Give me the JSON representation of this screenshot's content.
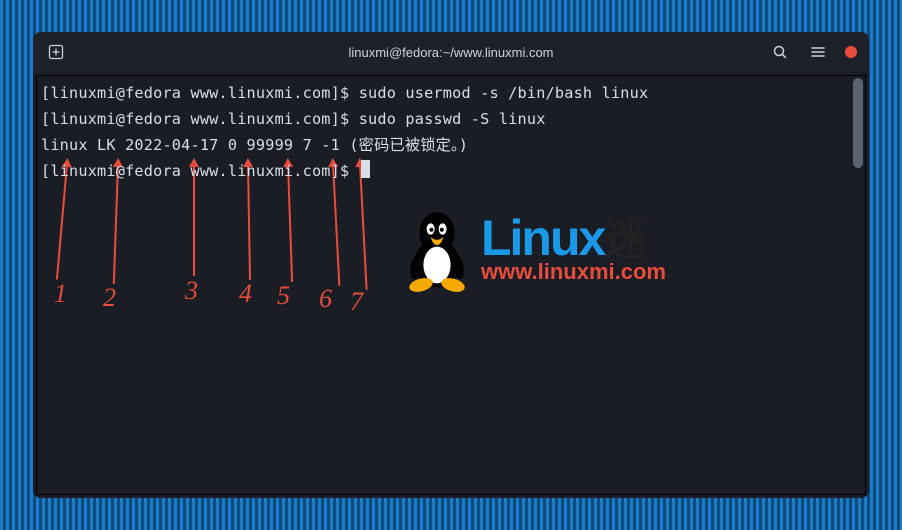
{
  "title": "linuxmi@fedora:~/www.linuxmi.com",
  "prompt": "[linuxmi@fedora www.linuxmi.com]$ ",
  "lines": {
    "cmd1": "sudo usermod -s /bin/bash linux",
    "cmd2": "sudo passwd -S linux",
    "out1": "linux LK 2022-04-17 0 99999 7 -1 (密码已被锁定。)"
  },
  "annotations": {
    "labels": [
      "1",
      "2",
      "3",
      "4",
      "5",
      "6",
      "7"
    ]
  },
  "watermark": {
    "brand_en": "Linux",
    "brand_cn": "迷",
    "url": "www.linuxmi.com"
  },
  "icons": {
    "newtab": "new-tab",
    "search": "search",
    "menu": "menu",
    "close": "close"
  }
}
